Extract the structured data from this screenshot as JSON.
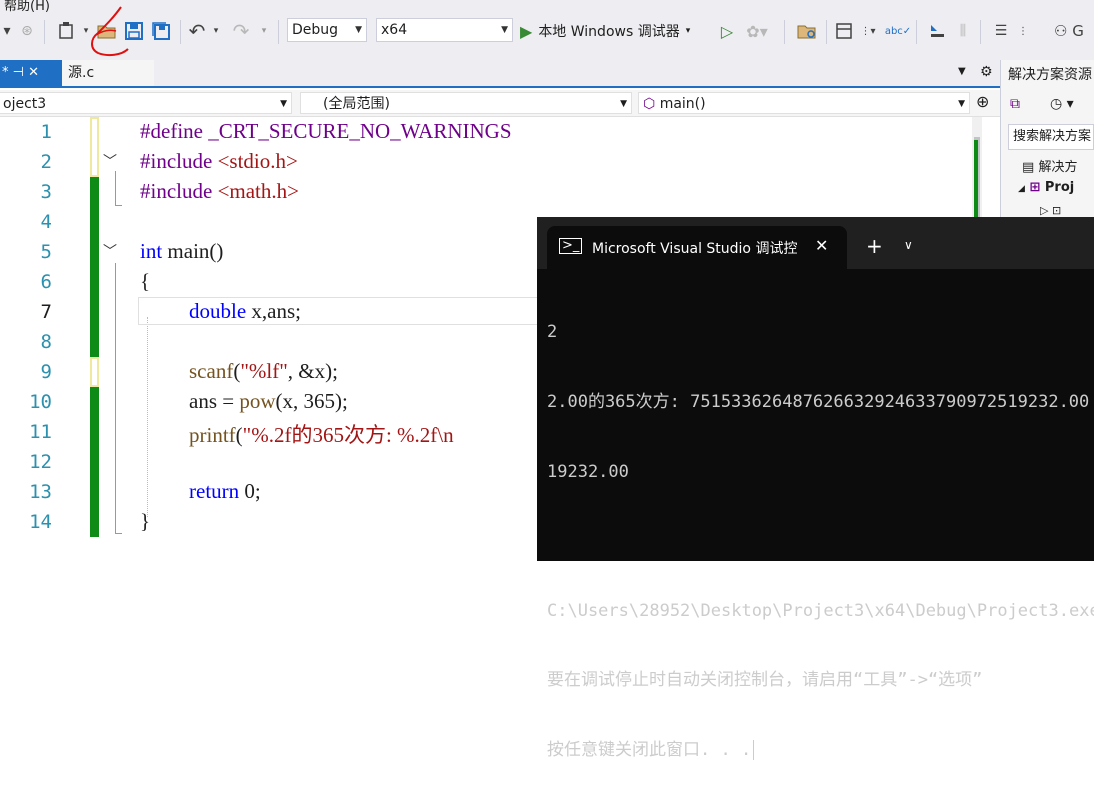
{
  "menu": {
    "help": "帮助(H)"
  },
  "toolbar": {
    "config": "Debug",
    "platform": "x64",
    "run_label": "本地 Windows 调试器",
    "extra": "G"
  },
  "tabs": {
    "active_marker": "* ⊣ ✕",
    "file": "源.c"
  },
  "navbar": {
    "project": "oject3",
    "scope": "(全局范围)",
    "member": "main()"
  },
  "editor": {
    "line_numbers": [
      "1",
      "2",
      "3",
      "4",
      "5",
      "6",
      "7",
      "8",
      "9",
      "10",
      "11",
      "12",
      "13",
      "14"
    ],
    "current_line": "7"
  },
  "code": {
    "l1_kw": "#define",
    "l1_rest": " _CRT_SECURE_NO_WARNINGS",
    "l2_kw": "#include",
    "l2_rest": " <stdio.h>",
    "l3_kw": "#include",
    "l3_rest": " <math.h>",
    "l5_kw": "int",
    "l5_rest": " main()",
    "l6": "{",
    "l7_kw": "double",
    "l7_rest": " x,ans;",
    "l9_fn": "scanf",
    "l9_open": "(",
    "l9_str": "\"%lf\"",
    "l9_rest": ", &x);",
    "l10_a": "ans = ",
    "l10_fn": "pow",
    "l10_rest": "(x, 365);",
    "l11_fn": "printf",
    "l11_open": "(",
    "l11_str": "\"%.2f的365次方: %.2f\\n",
    "l13_kw": "return",
    "l13_rest": " 0;",
    "l14": "}"
  },
  "solution": {
    "title": "解决方案资源",
    "search_placeholder": "搜索解决方案",
    "node1": "解决方",
    "node2": "Proj"
  },
  "terminal": {
    "tab_title": "Microsoft Visual Studio 调试控",
    "lines": [
      "2",
      "2.00的365次方: 751533626487626632924633790972519232.00",
      "19232.00",
      "",
      "C:\\Users\\28952\\Desktop\\Project3\\x64\\Debug\\Project3.exe",
      "要在调试停止时自动关闭控制台，请启用“工具”->“选项”",
      "按任意键关闭此窗口. . ."
    ]
  },
  "colors": {
    "accent": "#1f6fc5",
    "terminal_bg": "#0c0c0c",
    "gutter_green": "#0e8a16"
  }
}
